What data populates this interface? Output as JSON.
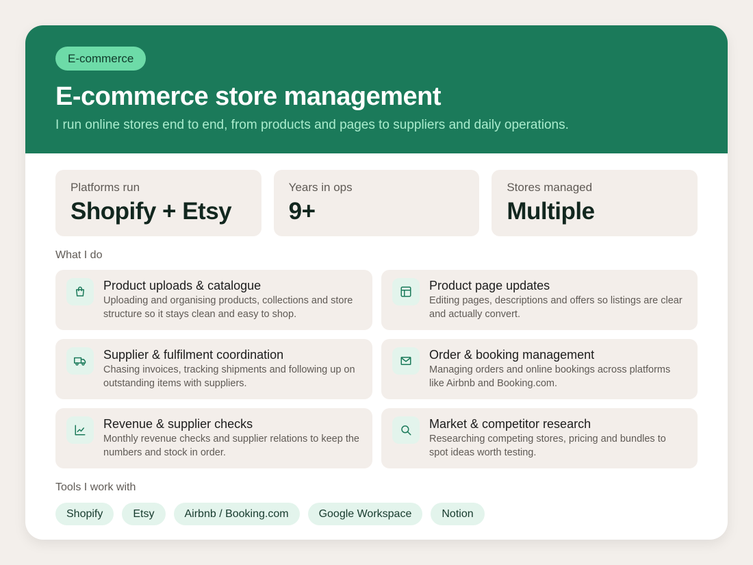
{
  "hero": {
    "tag": "E-commerce",
    "title": "E-commerce store management",
    "subtitle": "I run online stores end to end, from products and pages to suppliers and daily operations."
  },
  "stats": [
    {
      "label": "Platforms run",
      "value": "Shopify + Etsy"
    },
    {
      "label": "Years in ops",
      "value": "9+"
    },
    {
      "label": "Stores managed",
      "value": "Multiple"
    }
  ],
  "features_title": "What I do",
  "features": [
    {
      "icon": "shopping-bag-icon",
      "title": "Product uploads & catalogue",
      "desc": "Uploading and organising products, collections and store structure so it stays clean and easy to shop."
    },
    {
      "icon": "layout-icon",
      "title": "Product page updates",
      "desc": "Editing pages, descriptions and offers so listings are clear and actually convert."
    },
    {
      "icon": "truck-icon",
      "title": "Supplier & fulfilment coordination",
      "desc": "Chasing invoices, tracking shipments and following up on outstanding items with suppliers."
    },
    {
      "icon": "mail-icon",
      "title": "Order & booking management",
      "desc": "Managing orders and online bookings across platforms like Airbnb and Booking.com."
    },
    {
      "icon": "line-chart-icon",
      "title": "Revenue & supplier checks",
      "desc": "Monthly revenue checks and supplier relations to keep the numbers and stock in order."
    },
    {
      "icon": "search-icon",
      "title": "Market & competitor research",
      "desc": "Researching competing stores, pricing and bundles to spot ideas worth testing."
    }
  ],
  "tools_title": "Tools I work with",
  "tools": [
    "Shopify",
    "Etsy",
    "Airbnb / Booking.com",
    "Google Workspace",
    "Notion"
  ],
  "colors": {
    "header": "#1b7a5a",
    "tag": "#6ddba8",
    "subtitle": "#a9eccd",
    "tile": "#f3eeea",
    "chip": "#e3f4ec"
  }
}
